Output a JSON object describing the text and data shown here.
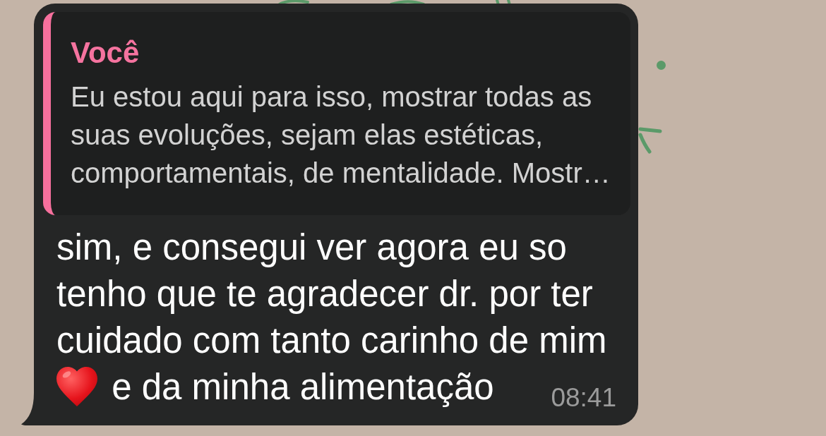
{
  "message": {
    "quoted": {
      "sender": "Você",
      "text": "Eu estou aqui para isso, mostrar todas as suas evoluções, sejam elas estéticas, comportamentais, de mentalidade. Mostr…"
    },
    "parts": [
      {
        "kind": "text",
        "text": "sim, e consegui ver agora eu so tenho que te agradecer dr. por ter cuidado com tanto carinho de mim"
      },
      {
        "kind": "heart"
      },
      {
        "kind": "text",
        "text": "e da minha alimentação"
      }
    ],
    "time": "08:41"
  }
}
